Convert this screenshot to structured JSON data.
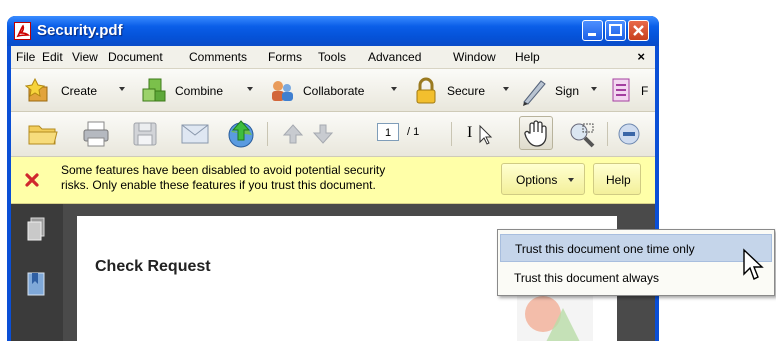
{
  "window": {
    "title": "Security.pdf"
  },
  "menubar": {
    "items": [
      "File",
      "Edit",
      "View",
      "Document",
      "Comments",
      "Forms",
      "Tools",
      "Advanced",
      "Window",
      "Help"
    ],
    "close_glyph": "×"
  },
  "toolbar1": {
    "create": "Create",
    "combine": "Combine",
    "collaborate": "Collaborate",
    "secure": "Secure",
    "sign": "Sign",
    "forms_partial": "F"
  },
  "toolbar2": {
    "page_number": "1",
    "page_total": "/ 1",
    "text_select_glyph": "I"
  },
  "security_bar": {
    "message_line1": "Some features have been disabled to avoid potential security",
    "message_line2": "risks. Only enable these features if you trust this document.",
    "options_label": "Options",
    "help_label": "Help"
  },
  "document": {
    "title": "Check Request"
  },
  "options_menu": {
    "items": [
      {
        "label": "Trust this document one time only",
        "highlighted": true
      },
      {
        "label": "Trust this document always",
        "highlighted": false
      }
    ]
  },
  "colors": {
    "titlebar": "#0a5ee8",
    "security_bar": "#ffffa8",
    "menu_highlight": "#c5d5ea"
  }
}
